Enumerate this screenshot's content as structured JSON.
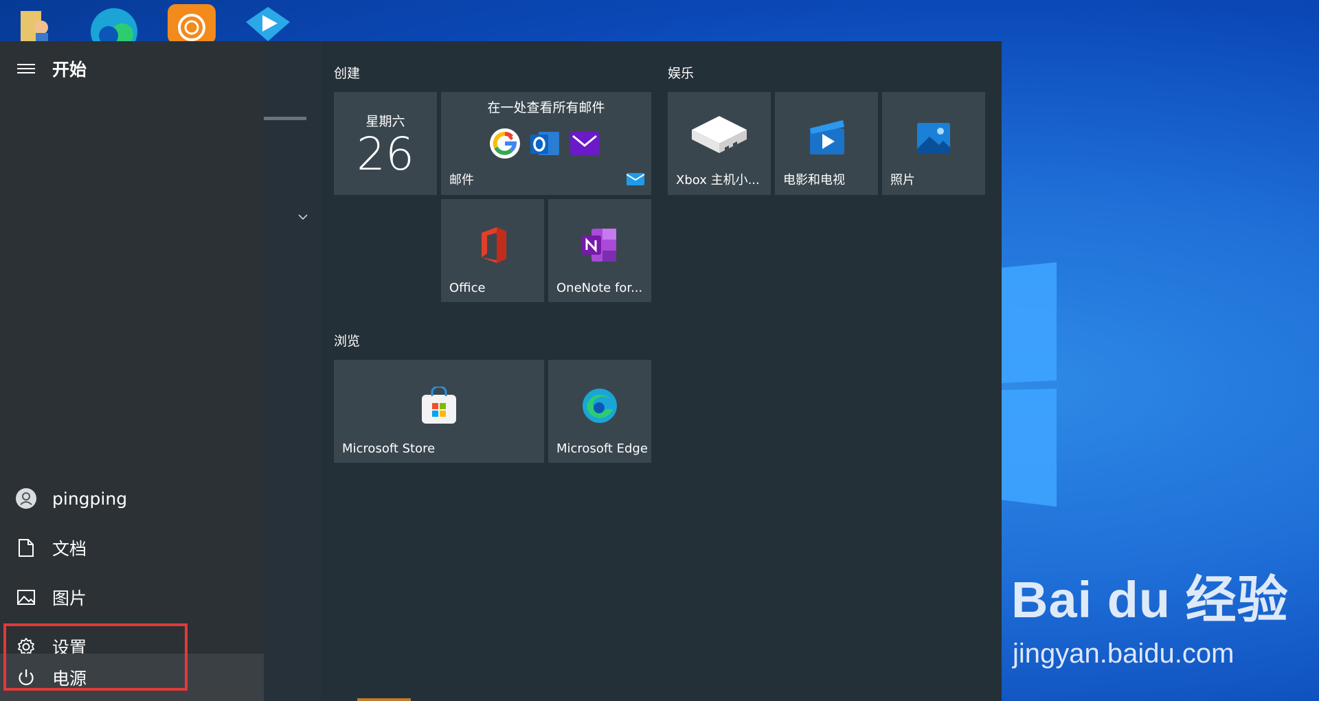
{
  "start_menu": {
    "header": "开始",
    "sidebar": {
      "user": "pingping",
      "documents": "文档",
      "pictures": "图片",
      "settings": "设置",
      "power": "电源"
    },
    "groups": {
      "create": {
        "title": "创建",
        "calendar": {
          "day": "星期六",
          "date": "26"
        },
        "mail": {
          "headline": "在一处查看所有邮件",
          "label": "邮件"
        },
        "office": {
          "label": "Office"
        },
        "onenote": {
          "label": "OneNote for..."
        }
      },
      "browse": {
        "title": "浏览",
        "store": {
          "label": "Microsoft Store"
        },
        "edge": {
          "label": "Microsoft Edge"
        }
      },
      "entertainment": {
        "title": "娱乐",
        "xbox": {
          "label": "Xbox 主机小..."
        },
        "movies": {
          "label": "电影和电视"
        },
        "photos": {
          "label": "照片"
        }
      }
    }
  },
  "watermark": {
    "logo": "Bai du 经验",
    "url": "jingyan.baidu.com"
  },
  "colors": {
    "desktop": "#1f6fd8",
    "tile": "#3a464e",
    "highlight": "#e03a3a"
  }
}
